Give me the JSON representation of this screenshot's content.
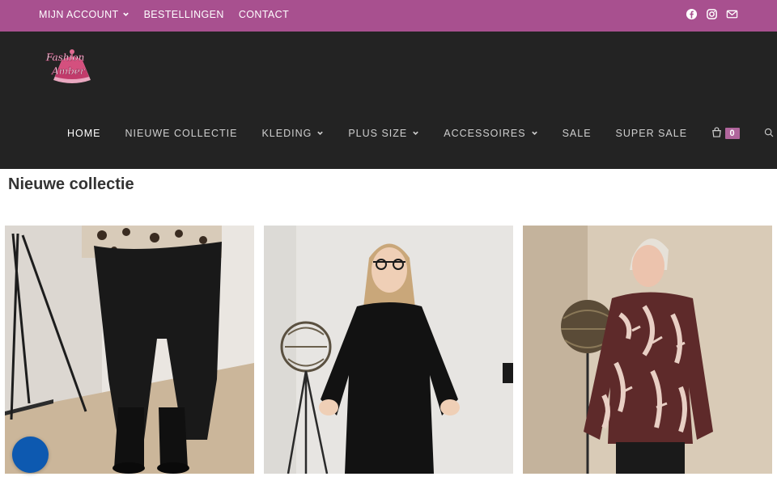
{
  "topbar": {
    "links": [
      {
        "label": "MIJN ACCOUNT",
        "has_dropdown": true
      },
      {
        "label": "BESTELLINGEN",
        "has_dropdown": false
      },
      {
        "label": "CONTACT",
        "has_dropdown": false
      }
    ],
    "social_icons": [
      "facebook-icon",
      "instagram-icon",
      "mail-icon"
    ],
    "background_color": "#a8508f"
  },
  "header": {
    "logo_text_line1": "Fashion",
    "logo_text_line2": "Amber",
    "background_color": "#232323",
    "nav": [
      {
        "label": "HOME",
        "active": true,
        "has_dropdown": false
      },
      {
        "label": "NIEUWE COLLECTIE",
        "active": false,
        "has_dropdown": false
      },
      {
        "label": "KLEDING",
        "active": false,
        "has_dropdown": true
      },
      {
        "label": "PLUS SIZE",
        "active": false,
        "has_dropdown": true
      },
      {
        "label": "ACCESSOIRES",
        "active": false,
        "has_dropdown": true
      },
      {
        "label": "SALE",
        "active": false,
        "has_dropdown": false
      },
      {
        "label": "SUPER SALE",
        "active": false,
        "has_dropdown": false
      }
    ],
    "cart_count": "0",
    "accent_color": "#b0659c"
  },
  "main": {
    "page_title": "Nieuwe collectie",
    "products": [
      {
        "image": "black-trousers-leopard-top"
      },
      {
        "image": "black-blouse"
      },
      {
        "image": "leaf-print-blouse"
      }
    ]
  },
  "chat": {
    "icon": "chat-bubble-icon",
    "color": "#0d59b0"
  }
}
